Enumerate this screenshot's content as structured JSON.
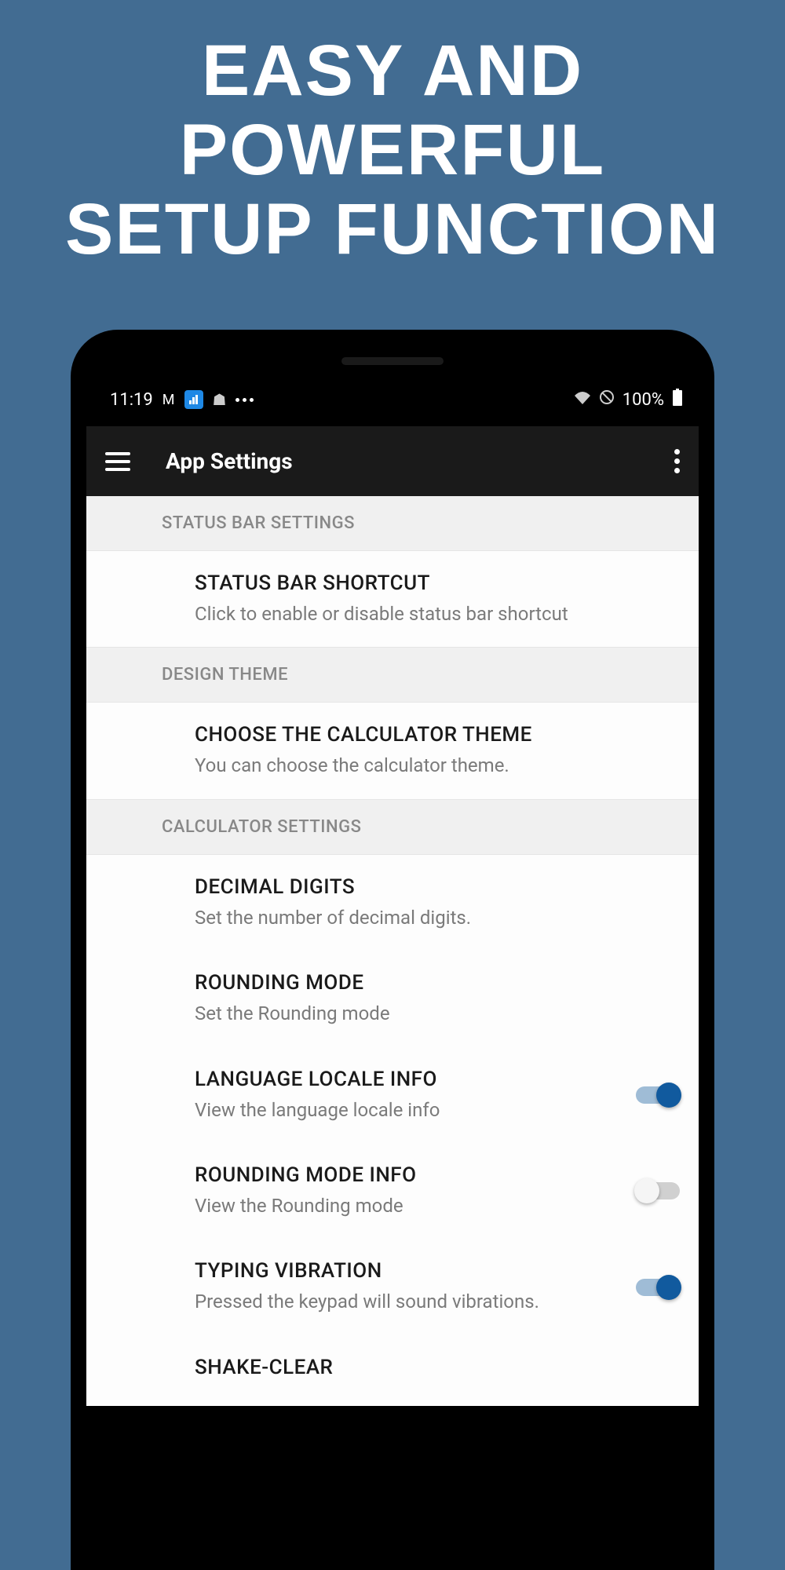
{
  "headline_line1": "EASY AND POWERFUL",
  "headline_line2": "SETUP FUNCTION",
  "status_bar": {
    "time": "11:19",
    "battery": "100%"
  },
  "header": {
    "title": "App Settings"
  },
  "sections": {
    "status_bar_section": {
      "label": "STATUS BAR SETTINGS",
      "shortcut": {
        "title": "STATUS BAR SHORTCUT",
        "desc": "Click to enable or disable status bar shortcut"
      }
    },
    "design": {
      "label": "DESIGN THEME",
      "theme": {
        "title": "CHOOSE THE CALCULATOR THEME",
        "desc": "You can choose the calculator theme."
      }
    },
    "calculator": {
      "label": "CALCULATOR SETTINGS",
      "decimal": {
        "title": "DECIMAL DIGITS",
        "desc": "Set the number of decimal digits."
      },
      "rounding": {
        "title": "ROUNDING MODE",
        "desc": "Set the Rounding mode"
      },
      "language": {
        "title": "LANGUAGE LOCALE INFO",
        "desc": "View the language locale info",
        "toggled": true
      },
      "rounding_info": {
        "title": "ROUNDING MODE INFO",
        "desc": "View the Rounding mode",
        "toggled": false
      },
      "vibration": {
        "title": "TYPING VIBRATION",
        "desc": "Pressed the keypad will sound vibrations.",
        "toggled": true
      },
      "shake": {
        "title": "SHAKE-CLEAR"
      }
    }
  }
}
